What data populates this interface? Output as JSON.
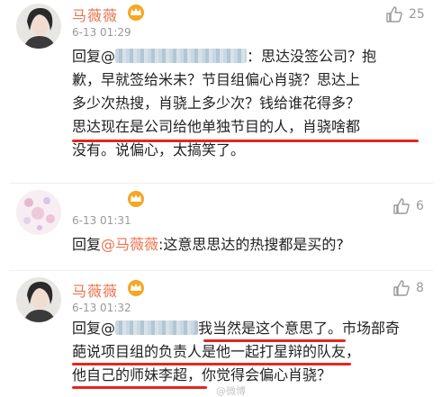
{
  "comments": [
    {
      "user": "马薇薇",
      "time": "6-13 01:29",
      "likes": "25",
      "reply_prefix": "回复@",
      "lines": [
        "：思达没签公司？抱",
        "歉，早就签给米未？节目组偏心肖骁？思达上",
        "多少次热搜，肖骁上多少次？钱给谁花得多？",
        "思达现在是公司给他单独节目的人，肖骁啥都",
        "没有。说偏心，太搞笑了。"
      ]
    },
    {
      "user": "",
      "time": "6-13 01:31",
      "likes": "6",
      "reply_prefix": "回复",
      "mention": "@马薇薇",
      "text": ":这意思思达的热搜都是买的?"
    },
    {
      "user": "马薇薇",
      "time": "6-13 01:32",
      "likes": "8",
      "reply_prefix": "回复@",
      "lines": [
        "我当然是这个意思了。市场部奇",
        "葩说项目组的负责人是他一起打星辩的队友，",
        "他自己的师妹李超，你觉得会偏心肖骁？"
      ]
    }
  ],
  "watermark": "@微博"
}
